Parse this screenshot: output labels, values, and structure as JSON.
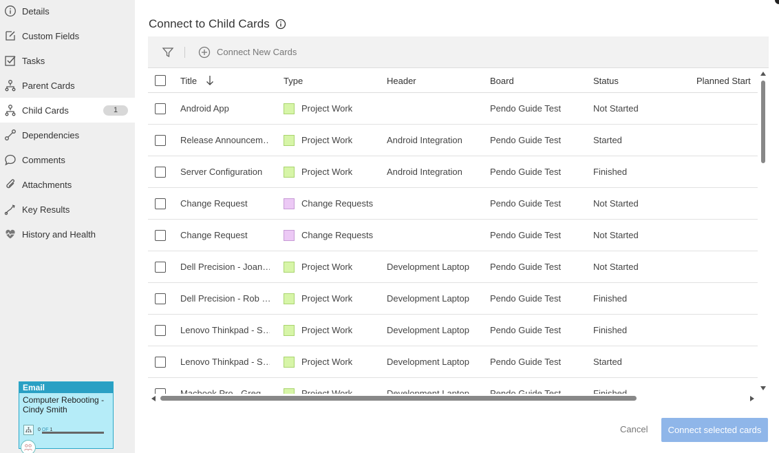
{
  "sidebar": {
    "items": [
      {
        "label": "Details",
        "icon": "info-icon"
      },
      {
        "label": "Custom Fields",
        "icon": "edit-icon"
      },
      {
        "label": "Tasks",
        "icon": "checkbox-icon"
      },
      {
        "label": "Parent Cards",
        "icon": "hierarchy-icon"
      },
      {
        "label": "Child Cards",
        "icon": "hierarchy-icon",
        "badge": "1",
        "active": true
      },
      {
        "label": "Dependencies",
        "icon": "link-icon"
      },
      {
        "label": "Comments",
        "icon": "comment-icon"
      },
      {
        "label": "Attachments",
        "icon": "paperclip-icon"
      },
      {
        "label": "Key Results",
        "icon": "key-results-icon"
      },
      {
        "label": "History and Health",
        "icon": "heart-icon"
      }
    ]
  },
  "mini_card": {
    "type": "Email",
    "title": "Computer Rebooting - Cindy Smith",
    "progress_done": "0",
    "progress_of": "OF",
    "progress_total": "1",
    "color": "#b5ecf8"
  },
  "main": {
    "title": "Connect to Child Cards",
    "toolbar": {
      "connect_new_label": "Connect New Cards"
    },
    "columns": [
      "Title",
      "Type",
      "Header",
      "Board",
      "Status",
      "Planned Start"
    ],
    "rows": [
      {
        "title": "Android App",
        "type": "Project Work",
        "type_color": "#d7f5a8",
        "header": "",
        "board": "Pendo Guide Test",
        "status": "Not Started"
      },
      {
        "title": "Release Announcem…",
        "type": "Project Work",
        "type_color": "#d7f5a8",
        "header": "Android Integration",
        "board": "Pendo Guide Test",
        "status": "Started"
      },
      {
        "title": "Server Configuration",
        "type": "Project Work",
        "type_color": "#d7f5a8",
        "header": "Android Integration",
        "board": "Pendo Guide Test",
        "status": "Finished"
      },
      {
        "title": "Change Request",
        "type": "Change Requests",
        "type_color": "#ecc9f5",
        "header": "",
        "board": "Pendo Guide Test",
        "status": "Not Started"
      },
      {
        "title": "Change Request",
        "type": "Change Requests",
        "type_color": "#ecc9f5",
        "header": "",
        "board": "Pendo Guide Test",
        "status": "Not Started"
      },
      {
        "title": "Dell Precision - Joan…",
        "type": "Project Work",
        "type_color": "#d7f5a8",
        "header": "Development Laptop",
        "board": "Pendo Guide Test",
        "status": "Not Started"
      },
      {
        "title": "Dell Precision - Rob …",
        "type": "Project Work",
        "type_color": "#d7f5a8",
        "header": "Development Laptop",
        "board": "Pendo Guide Test",
        "status": "Finished"
      },
      {
        "title": "Lenovo Thinkpad - S…",
        "type": "Project Work",
        "type_color": "#d7f5a8",
        "header": "Development Laptop",
        "board": "Pendo Guide Test",
        "status": "Finished"
      },
      {
        "title": "Lenovo Thinkpad - S…",
        "type": "Project Work",
        "type_color": "#d7f5a8",
        "header": "Development Laptop",
        "board": "Pendo Guide Test",
        "status": "Started"
      },
      {
        "title": "Macbook Pro - Greg…",
        "type": "Project Work",
        "type_color": "#d7f5a8",
        "header": "Development Laptop",
        "board": "Pendo Guide Test",
        "status": "Finished"
      }
    ],
    "cancel_label": "Cancel",
    "connect_selected_label": "Connect selected cards"
  }
}
